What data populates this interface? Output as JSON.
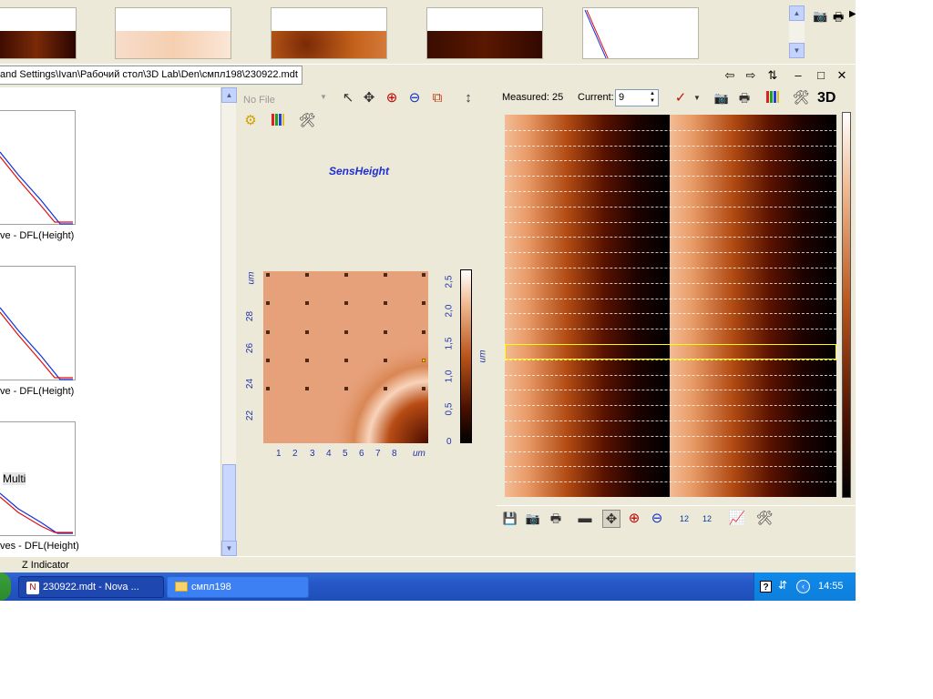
{
  "path": {
    "text": "and Settings\\Ivan\\Рабочий стол\\3D Lab\\Den\\смпл198\\230922.mdt"
  },
  "left_panel": {
    "captions": [
      "ve - DFL(Height)",
      "ve - DFL(Height)",
      "ves - DFL(Height)"
    ],
    "multi_label": "Multi"
  },
  "z_indicator": "Z Indicator",
  "middle": {
    "file_select": "No File",
    "title": "SensHeight",
    "y_ticks": [
      "um",
      "28",
      "26",
      "24",
      "22"
    ],
    "x_ticks": [
      "1",
      "2",
      "3",
      "4",
      "5",
      "6",
      "7",
      "8",
      "um"
    ],
    "cbar_ticks": [
      "2,5",
      "2,0",
      "1,5",
      "1,0",
      "0,5",
      "0"
    ],
    "cbar_unit": "um"
  },
  "right": {
    "measured_label": "Measured: 25",
    "current_label": "Current:",
    "current_value": "9",
    "view_3d": "3D",
    "selected_row": 9,
    "row_count": 25
  },
  "taskbar": {
    "task1": "230922.mdt - Nova ...",
    "task2": "смпл198",
    "clock": "14:55",
    "help": "?"
  },
  "colors": {
    "window_bg": "#ece9d8",
    "taskbar": "#245edb",
    "highlight": "#ffff00",
    "curve_red": "#e01010",
    "curve_blue": "#1030e0",
    "axis_text": "#2233aa"
  }
}
